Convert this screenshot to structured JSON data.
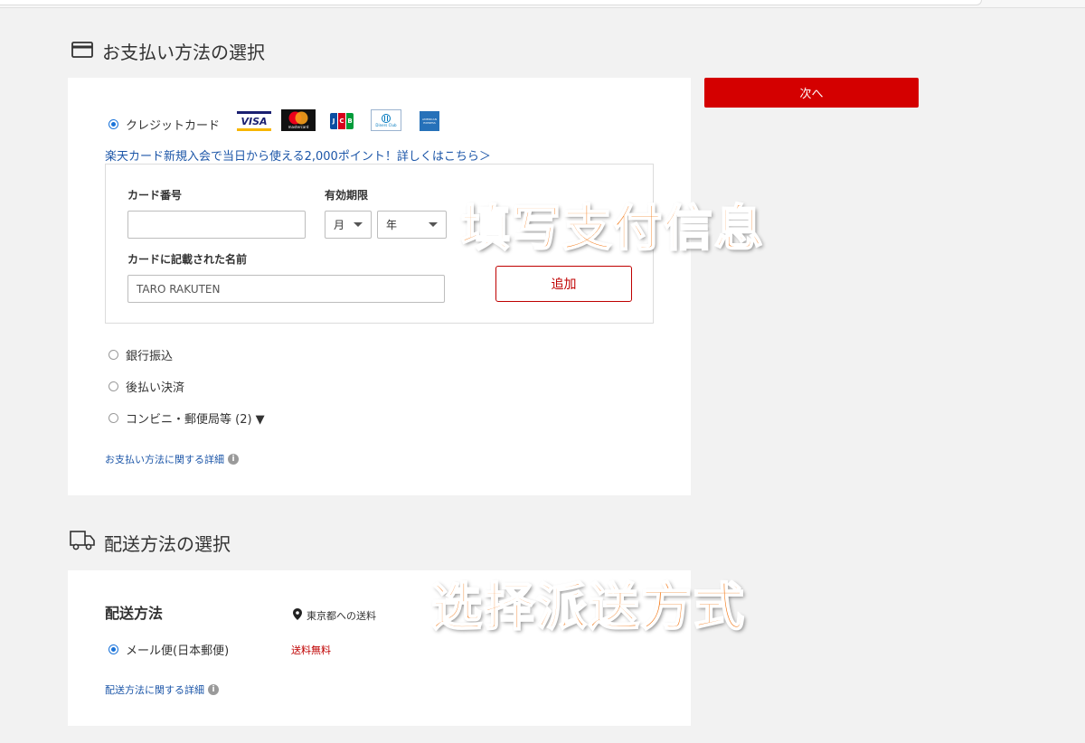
{
  "payment": {
    "section_title": "お支払い方法の選択",
    "credit_card_label": "クレジットカード",
    "card_brands": [
      "VISA",
      "mastercard",
      "JCB",
      "Diners Club",
      "AMERICAN EXPRESS"
    ],
    "promo_link": "楽天カード新規入会で当日から使える2,000ポイント！詳しくはこちら＞",
    "card_number_label": "カード番号",
    "card_number_value": "",
    "expiry_label": "有効期限",
    "month_value": "月",
    "year_value": "年",
    "name_label": "カードに記載された名前",
    "name_placeholder": "TARO RAKUTEN",
    "add_button": "追加",
    "option_bank": "銀行振込",
    "option_deferred": "後払い決済",
    "option_convenience": "コンビニ・郵便局等 (2) ▼",
    "details_link": "お支払い方法に関する詳細"
  },
  "next_button": "次へ",
  "shipping": {
    "section_title": "配送方法の選択",
    "method_heading": "配送方法",
    "destination": "東京都への送料",
    "method_option": "メール便(日本郵便)",
    "shipping_fee": "送料無料",
    "details_link": "配送方法に関する詳細"
  },
  "overlays": {
    "fill_payment": "填写支付信息",
    "choose_shipping": "选择派送方式"
  },
  "colors": {
    "accent_red": "#d40000",
    "link_blue": "#1c56a8",
    "overlay_orange": "#f27a1a"
  }
}
